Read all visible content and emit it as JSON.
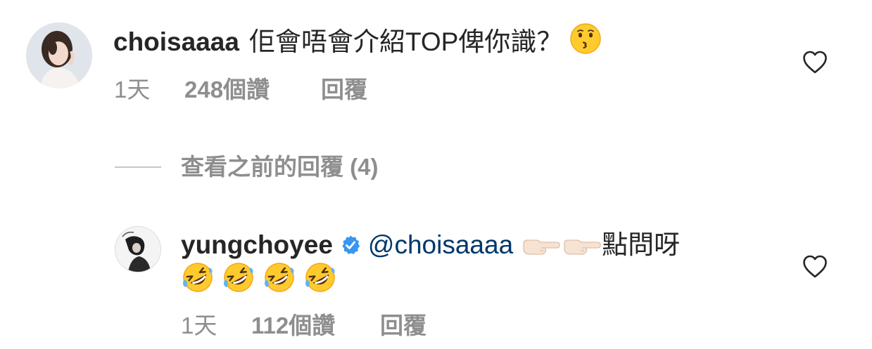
{
  "comments": [
    {
      "username": "choisaaaa",
      "text": "佢會唔會介紹TOP俾你識？",
      "emoji": "kissing-face",
      "time": "1天",
      "likes": "248個讚",
      "reply": "回覆"
    },
    {
      "username": "yungchoyee",
      "verified": true,
      "mention": "@choisaaaa",
      "text": "點問呀",
      "emoji_before_text": [
        "backhand-index-pointing-right",
        "backhand-index-pointing-right"
      ],
      "emoji_line2": [
        "rolling-on-the-floor-laughing",
        "rolling-on-the-floor-laughing",
        "rolling-on-the-floor-laughing",
        "rolling-on-the-floor-laughing"
      ],
      "time": "1天",
      "likes": "112個讚",
      "reply": "回覆"
    }
  ],
  "view_previous_replies": "查看之前的回覆 (4)",
  "colors": {
    "text": "#262626",
    "secondary": "#8e8e8e",
    "mention": "#00376b",
    "verified": "#3897f0",
    "divider": "#c7c7c7"
  }
}
